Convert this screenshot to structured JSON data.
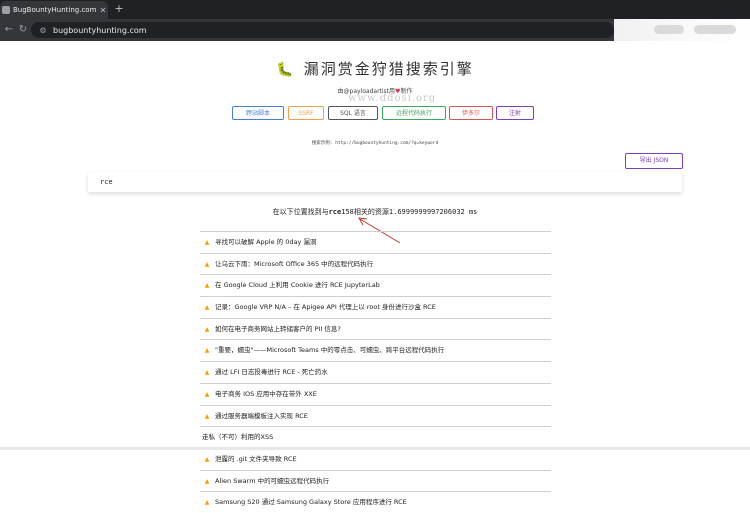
{
  "browser": {
    "tab_title": "BugBountyHunting.com - Bi",
    "tab_close": "✕",
    "new_tab": "+",
    "url": "bugbountyhunting.com",
    "nav": {
      "back": "←",
      "forward": "→",
      "reload": "↻"
    }
  },
  "page": {
    "title": "漏洞赏金狩猎搜索引擎",
    "byline_prefix": "由@payloadartist用",
    "byline_suffix": "制作",
    "watermark": "www.ddosi.org",
    "category_buttons": [
      {
        "label": "跨站脚本",
        "color": "#4a7fd4"
      },
      {
        "label": "SSRF",
        "color": "#f0a04b"
      },
      {
        "label": "SQL 语言",
        "color": "#555555"
      },
      {
        "label": "远程代码执行",
        "color": "#3fa65e"
      },
      {
        "label": "伊多尔",
        "color": "#d9534f"
      },
      {
        "label": "注射",
        "color": "#7b3fc4"
      }
    ],
    "example": "搜索示例: http://bugbountyhunting.com/?q=keyword",
    "export_label": "导出 JSON",
    "search_value": "rce",
    "result_prefix": "在以下位置找到与",
    "result_keyword": "rce",
    "result_count": "158",
    "result_middle": "相关的资源",
    "result_time": "1.6999999997206032 ms",
    "results": [
      {
        "title": "寻找可以破解 Apple 的 0day 漏洞",
        "fire": true
      },
      {
        "title": "让乌云下雨：Microsoft Office 365 中的远程代码执行",
        "fire": true
      },
      {
        "title": "在 Google Cloud 上利用 Cookie 进行 RCE JupyterLab",
        "fire": true
      },
      {
        "title": "记录：Google VRP N/A – 在 Apigee API 代理上以 root 身份进行沙盒 RCE",
        "fire": true
      },
      {
        "title": "如何在电子商务网站上转储客户的 PII 信息?",
        "fire": true
      },
      {
        "title": "\"重要，蠕虫\"——Microsoft Teams 中的零点击、可蠕虫、跨平台远程代码执行",
        "fire": true
      },
      {
        "title": "通过 LFI 日志投毒进行 RCE - 死亡药水",
        "fire": true
      },
      {
        "title": "电子商务 IOS 应用中存在带外 XXE",
        "fire": true
      },
      {
        "title": "通过服务器端模板注入实现 RCE",
        "fire": true
      },
      {
        "title": "走私（不可）利用的XSS",
        "fire": false
      },
      {
        "title": "泄露的 .git 文件夹导致 RCE",
        "fire": true
      },
      {
        "title": "Alien Swarm 中的可蠕虫远程代码执行",
        "fire": true
      },
      {
        "title": "Samsung S20 通过 Samsung Galaxy Store 应用程序进行 RCE",
        "fire": true
      }
    ]
  }
}
